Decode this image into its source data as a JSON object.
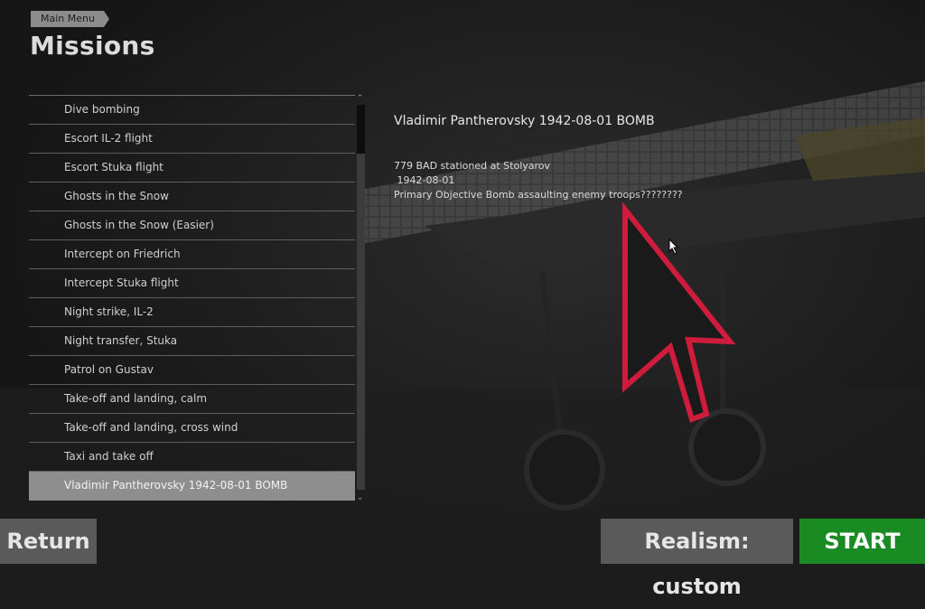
{
  "header": {
    "breadcrumb": "Main Menu",
    "title": "Missions"
  },
  "missions": {
    "items": [
      "Dive bombing",
      "Escort IL-2 flight",
      "Escort Stuka flight",
      "Ghosts in the Snow",
      "Ghosts in the Snow (Easier)",
      "Intercept on Friedrich",
      "Intercept Stuka flight",
      "Night strike, IL-2",
      "Night transfer, Stuka",
      "Patrol on Gustav",
      "Take-off and landing, calm",
      "Take-off and landing, cross wind",
      "Taxi and take off",
      "Vladimir Pantherovsky 1942-08-01 BOMB"
    ],
    "selected": "Vladimir Pantherovsky 1942-08-01 BOMB"
  },
  "scrollbar": {
    "up_icon": "chevron-up-icon",
    "down_icon": "chevron-down-icon"
  },
  "detail": {
    "title": "Vladimir Pantherovsky 1942-08-01 BOMB",
    "lines": [
      "779 BAD stationed at Stolyarov",
      " 1942-08-01",
      "Primary Objective Bomb assaulting enemy troops????????"
    ]
  },
  "buttons": {
    "return": "Return",
    "realism": "Realism: custom",
    "start": "START"
  },
  "colors": {
    "start": "#1a8a23",
    "button": "#5a5a5a",
    "selected_row": "#8e8e8e",
    "cursor_outline": "#d01c3c"
  }
}
